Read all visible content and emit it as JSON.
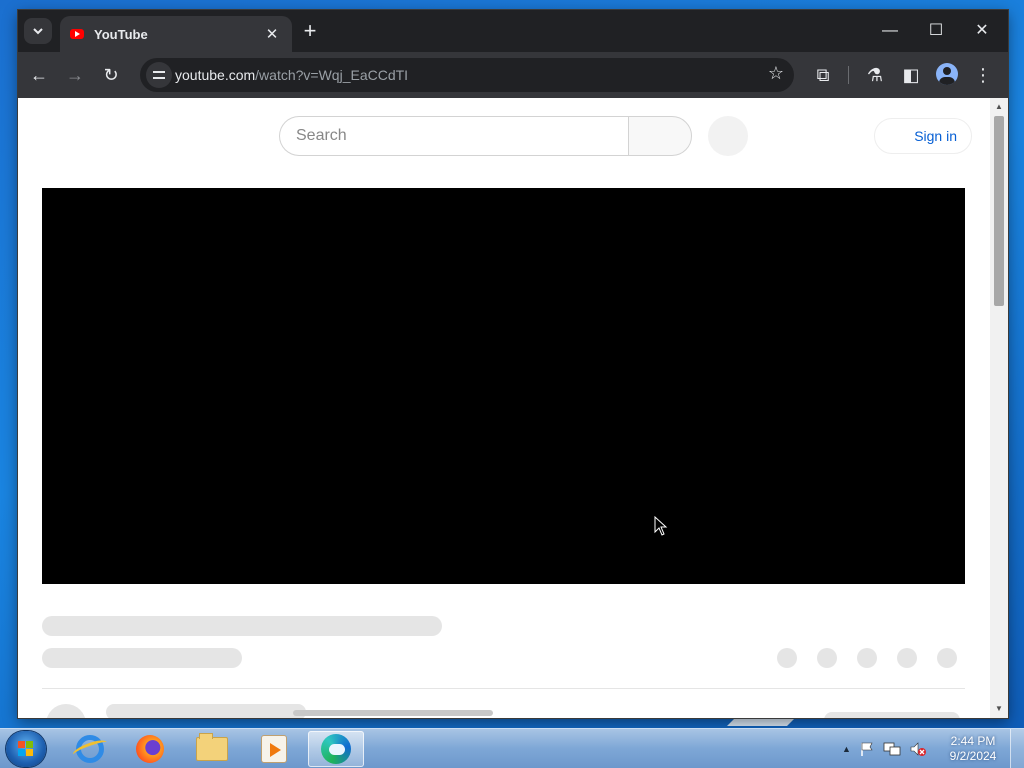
{
  "browser": {
    "tab_title": "YouTube",
    "tab_close": "✕",
    "new_tab": "+",
    "url_domain": "youtube.com",
    "url_path": "/watch?v=Wqj_EaCCdTI",
    "window_controls": {
      "minimize": "—",
      "maximize": "☐",
      "close": "✕"
    },
    "toolbar_icons": {
      "back": "←",
      "forward": "→",
      "reload": "↻",
      "star": "☆",
      "extensions": "⧉",
      "labs": "⚗",
      "side_panel": "◧",
      "menu": "⋮"
    }
  },
  "youtube": {
    "search_placeholder": "Search",
    "sign_in_label": "Sign in"
  },
  "taskbar": {
    "apps": [
      "internet-explorer",
      "firefox",
      "file-explorer",
      "media-player",
      "edge"
    ],
    "active_app": "edge",
    "tray_icons": [
      "show-hidden-icons",
      "action-center-flag",
      "network",
      "volume-muted"
    ],
    "tray_arrow": "▲",
    "clock_time": "2:44 PM",
    "clock_date": "9/2/2024"
  },
  "colors": {
    "titlebar": "#202124",
    "toolbar": "#35363a",
    "youtube_red": "#ff0000",
    "link_blue": "#065fd4",
    "player": "#000000"
  }
}
